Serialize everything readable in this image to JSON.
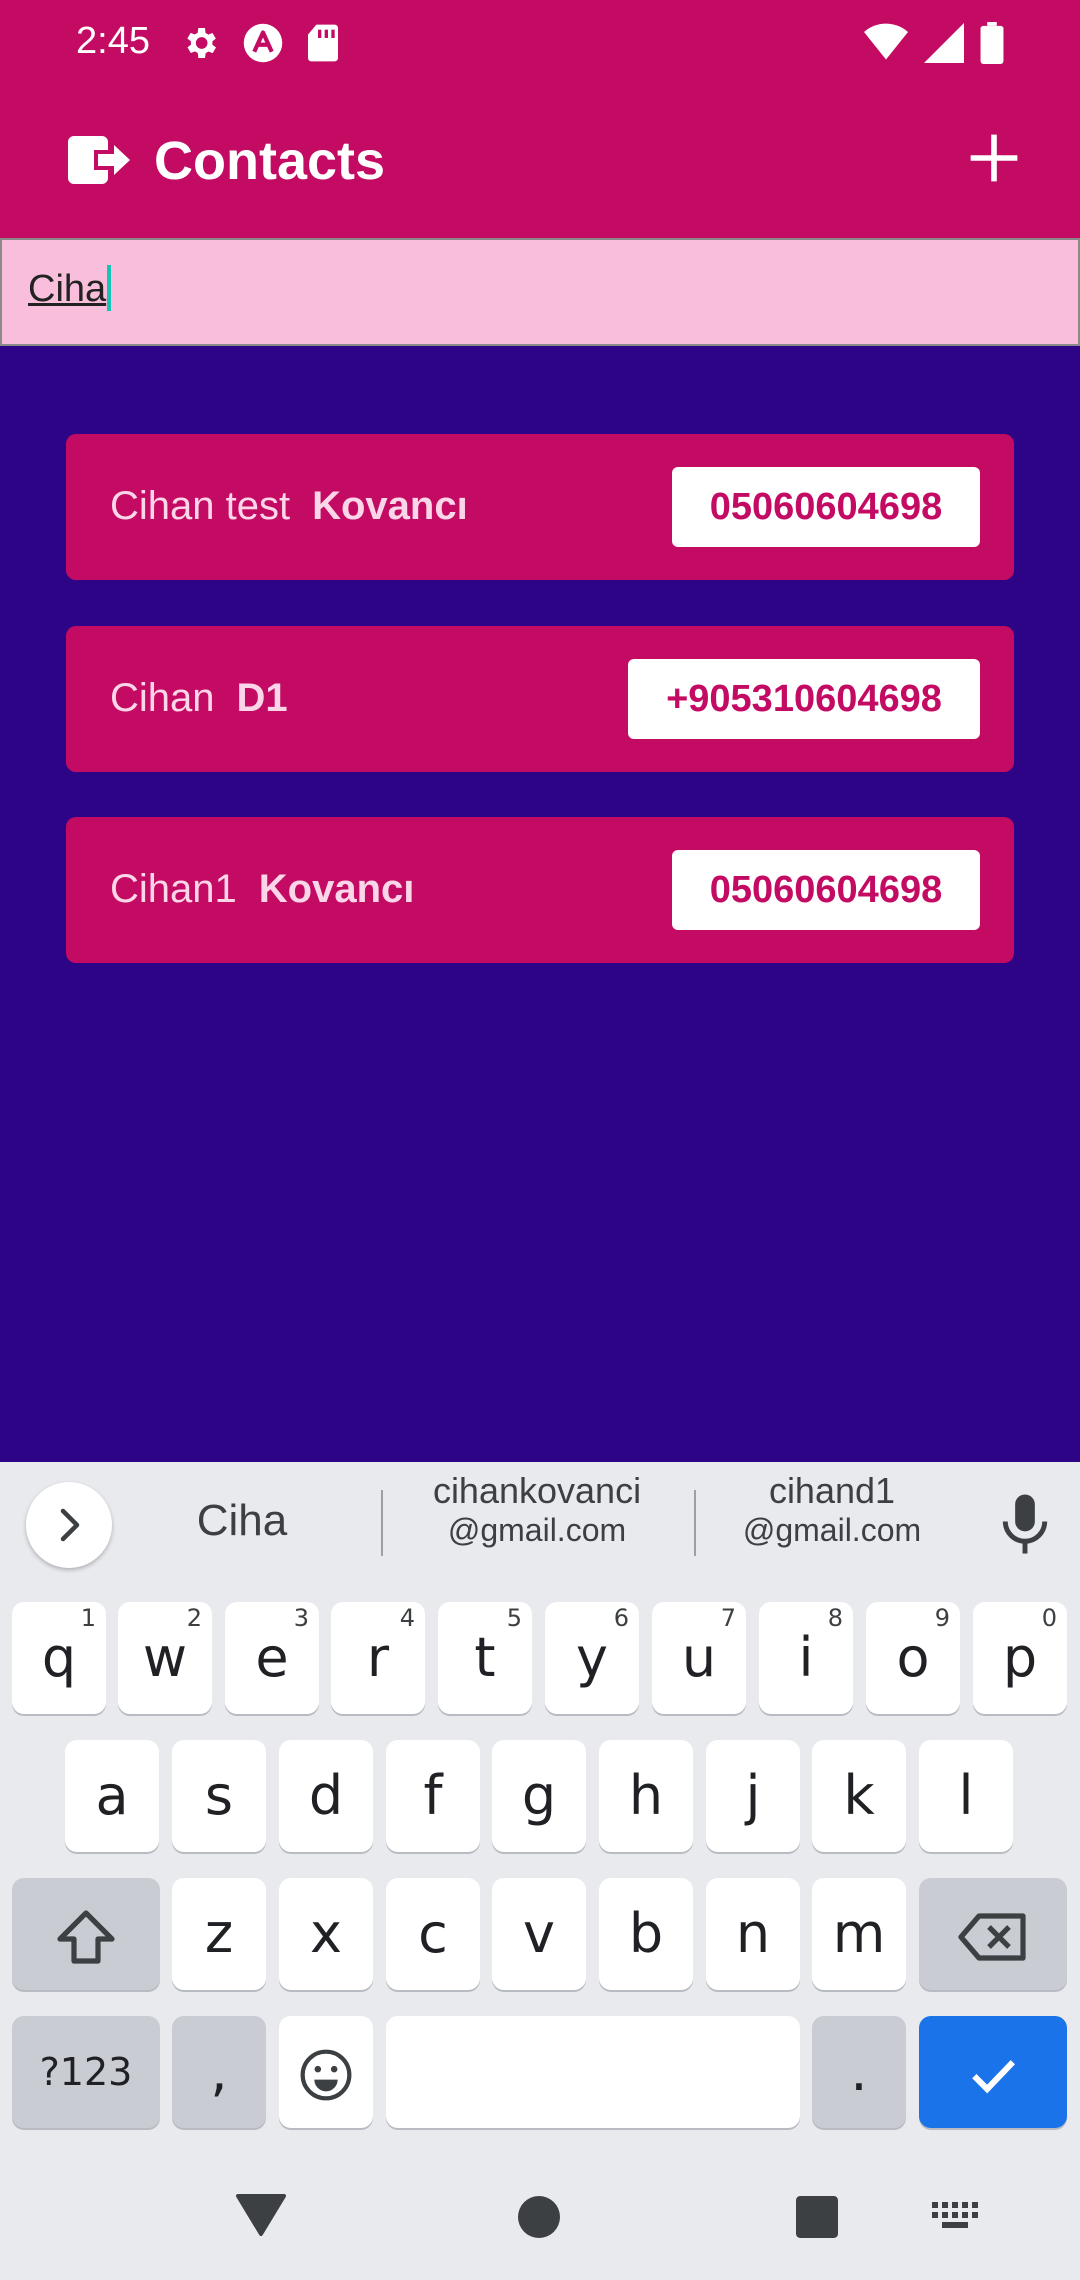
{
  "status_bar": {
    "time": "2:45",
    "left_icons": [
      "gear-icon",
      "a-icon",
      "sd-card-icon"
    ],
    "right_icons": [
      "wifi-icon",
      "signal-icon",
      "battery-icon"
    ]
  },
  "app_bar": {
    "title": "Contacts",
    "leading_icon": "logout-icon",
    "trailing_icon": "add-icon"
  },
  "search": {
    "value": "Ciha"
  },
  "contacts": [
    {
      "first_name": "Cihan test",
      "last_name": "Kovancı",
      "phone": "05060604698"
    },
    {
      "first_name": "Cihan",
      "last_name": "D1",
      "phone": "+905310604698"
    },
    {
      "first_name": "Cihan1",
      "last_name": "Kovancı",
      "phone": "05060604698"
    }
  ],
  "keyboard": {
    "suggestions": [
      {
        "line1": "Ciha"
      },
      {
        "line1": "cihankovanci",
        "line2": "@gmail.com"
      },
      {
        "line1": "cihand1",
        "line2": "@gmail.com"
      }
    ],
    "rows": [
      [
        {
          "k": "q",
          "h": "1"
        },
        {
          "k": "w",
          "h": "2"
        },
        {
          "k": "e",
          "h": "3"
        },
        {
          "k": "r",
          "h": "4"
        },
        {
          "k": "t",
          "h": "5"
        },
        {
          "k": "y",
          "h": "6"
        },
        {
          "k": "u",
          "h": "7"
        },
        {
          "k": "i",
          "h": "8"
        },
        {
          "k": "o",
          "h": "9"
        },
        {
          "k": "p",
          "h": "0"
        }
      ],
      [
        {
          "k": "a"
        },
        {
          "k": "s"
        },
        {
          "k": "d"
        },
        {
          "k": "f"
        },
        {
          "k": "g"
        },
        {
          "k": "h"
        },
        {
          "k": "j"
        },
        {
          "k": "k"
        },
        {
          "k": "l"
        }
      ],
      [
        {
          "k": "z"
        },
        {
          "k": "x"
        },
        {
          "k": "c"
        },
        {
          "k": "v"
        },
        {
          "k": "b"
        },
        {
          "k": "n"
        },
        {
          "k": "m"
        }
      ]
    ],
    "symbols_label": "?123",
    "comma": ",",
    "period": ".",
    "colors": {
      "enter": "#1a73e8"
    }
  },
  "colors": {
    "primary": "#c40b63",
    "background": "#2e0486",
    "search_bg": "#f8bedb"
  }
}
